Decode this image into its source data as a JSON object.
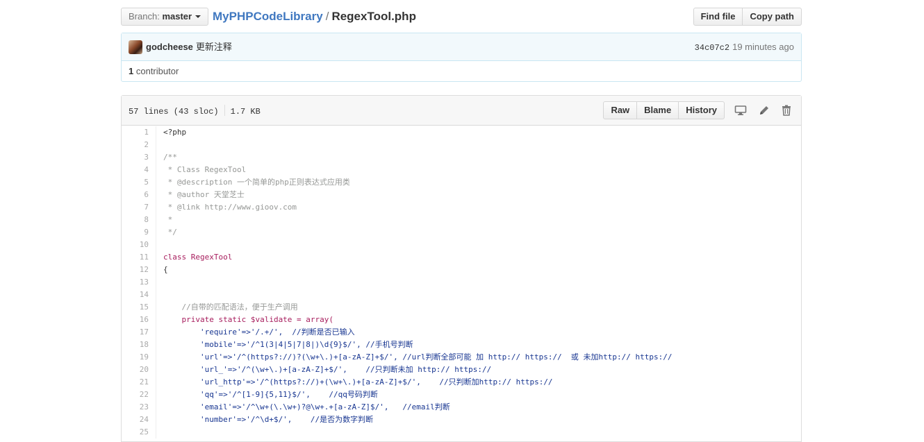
{
  "header": {
    "branch_label": "Branch:",
    "branch_value": "master",
    "repo": "MyPHPCodeLibrary",
    "separator": "/",
    "file": "RegexTool.php",
    "find_file": "Find file",
    "copy_path": "Copy path"
  },
  "commit": {
    "author": "godcheese",
    "message": "更新注释",
    "sha": "34c07c2",
    "time": "19 minutes ago",
    "contributors_count": "1",
    "contributors_label": "contributor"
  },
  "file": {
    "lines_info": "57 lines (43 sloc)",
    "size": "1.7 KB",
    "raw": "Raw",
    "blame": "Blame",
    "history": "History",
    "icons": [
      "desktop-icon",
      "pencil-icon",
      "trash-icon"
    ]
  },
  "code": [
    {
      "n": "1",
      "t": "<?php"
    },
    {
      "n": "2",
      "t": ""
    },
    {
      "n": "3",
      "t": "/**"
    },
    {
      "n": "4",
      "t": " * Class RegexTool"
    },
    {
      "n": "5",
      "t": " * @description 一个简单的php正则表达式应用类"
    },
    {
      "n": "6",
      "t": " * @author 天堂芝士"
    },
    {
      "n": "7",
      "t": " * @link http://www.gioov.com"
    },
    {
      "n": "8",
      "t": " *"
    },
    {
      "n": "9",
      "t": " */"
    },
    {
      "n": "10",
      "t": ""
    },
    {
      "n": "11",
      "t": "class RegexTool"
    },
    {
      "n": "12",
      "t": "{"
    },
    {
      "n": "13",
      "t": ""
    },
    {
      "n": "14",
      "t": ""
    },
    {
      "n": "15",
      "t": "    //自带的匹配语法，便于生产调用"
    },
    {
      "n": "16",
      "t": "    private static $validate = array("
    },
    {
      "n": "17",
      "t": "        'require'=>'/.+/',  //判断是否已输入"
    },
    {
      "n": "18",
      "t": "        'mobile'=>'/^1(3|4|5|7|8|)\\d{9}$/', //手机号判断"
    },
    {
      "n": "19",
      "t": "        'url'=>'/^(https?://)?(\\w+\\.)+[a-zA-Z]+$/', //url判断全部可能 加 http:// https://  或 未加http:// https://"
    },
    {
      "n": "20",
      "t": "        'url_'=>'/^(\\w+\\.)+[a-zA-Z]+$/',    //只判断未加 http:// https://"
    },
    {
      "n": "21",
      "t": "        'url_http'=>'/^(https?://)+(\\w+\\.)+[a-zA-Z]+$/',    //只判断加http:// https://"
    },
    {
      "n": "22",
      "t": "        'qq'=>'/^[1-9]{5,11}$/',    //qq号码判断"
    },
    {
      "n": "23",
      "t": "        'email'=>'/^\\w+(\\.\\w+)?@\\w+.+[a-zA-Z]$/',   //email判断"
    },
    {
      "n": "24",
      "t": "        'number'=>'/^\\d+$/',    //是否为数字判断"
    },
    {
      "n": "25",
      "t": ""
    }
  ]
}
